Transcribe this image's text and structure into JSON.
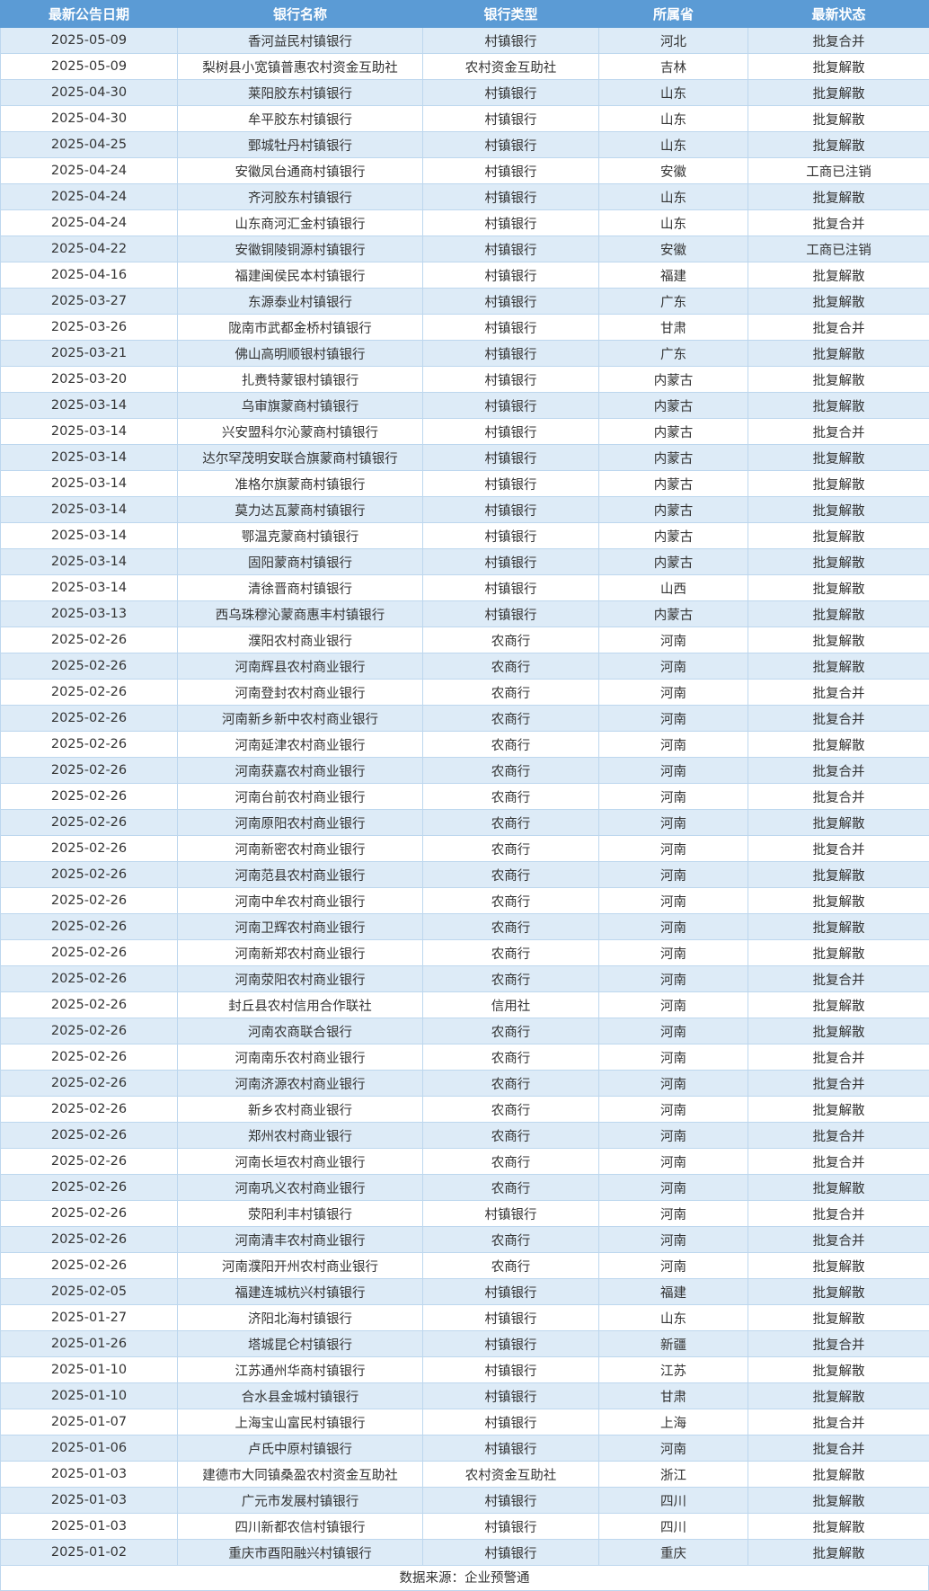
{
  "table": {
    "headers": [
      "最新公告日期",
      "银行名称",
      "银行类型",
      "所属省",
      "最新状态"
    ],
    "rows": [
      [
        "2025-05-09",
        "香河益民村镇银行",
        "村镇银行",
        "河北",
        "批复合并"
      ],
      [
        "2025-05-09",
        "梨树县小宽镇普惠农村资金互助社",
        "农村资金互助社",
        "吉林",
        "批复解散"
      ],
      [
        "2025-04-30",
        "莱阳胶东村镇银行",
        "村镇银行",
        "山东",
        "批复解散"
      ],
      [
        "2025-04-30",
        "牟平胶东村镇银行",
        "村镇银行",
        "山东",
        "批复解散"
      ],
      [
        "2025-04-25",
        "鄄城牡丹村镇银行",
        "村镇银行",
        "山东",
        "批复解散"
      ],
      [
        "2025-04-24",
        "安徽凤台通商村镇银行",
        "村镇银行",
        "安徽",
        "工商已注销"
      ],
      [
        "2025-04-24",
        "齐河胶东村镇银行",
        "村镇银行",
        "山东",
        "批复解散"
      ],
      [
        "2025-04-24",
        "山东商河汇金村镇银行",
        "村镇银行",
        "山东",
        "批复合并"
      ],
      [
        "2025-04-22",
        "安徽铜陵铜源村镇银行",
        "村镇银行",
        "安徽",
        "工商已注销"
      ],
      [
        "2025-04-16",
        "福建闽侯民本村镇银行",
        "村镇银行",
        "福建",
        "批复解散"
      ],
      [
        "2025-03-27",
        "东源泰业村镇银行",
        "村镇银行",
        "广东",
        "批复解散"
      ],
      [
        "2025-03-26",
        "陇南市武都金桥村镇银行",
        "村镇银行",
        "甘肃",
        "批复合并"
      ],
      [
        "2025-03-21",
        "佛山高明顺银村镇银行",
        "村镇银行",
        "广东",
        "批复解散"
      ],
      [
        "2025-03-20",
        "扎赉特蒙银村镇银行",
        "村镇银行",
        "内蒙古",
        "批复解散"
      ],
      [
        "2025-03-14",
        "乌审旗蒙商村镇银行",
        "村镇银行",
        "内蒙古",
        "批复解散"
      ],
      [
        "2025-03-14",
        "兴安盟科尔沁蒙商村镇银行",
        "村镇银行",
        "内蒙古",
        "批复合并"
      ],
      [
        "2025-03-14",
        "达尔罕茂明安联合旗蒙商村镇银行",
        "村镇银行",
        "内蒙古",
        "批复解散"
      ],
      [
        "2025-03-14",
        "准格尔旗蒙商村镇银行",
        "村镇银行",
        "内蒙古",
        "批复解散"
      ],
      [
        "2025-03-14",
        "莫力达瓦蒙商村镇银行",
        "村镇银行",
        "内蒙古",
        "批复解散"
      ],
      [
        "2025-03-14",
        "鄂温克蒙商村镇银行",
        "村镇银行",
        "内蒙古",
        "批复解散"
      ],
      [
        "2025-03-14",
        "固阳蒙商村镇银行",
        "村镇银行",
        "内蒙古",
        "批复解散"
      ],
      [
        "2025-03-14",
        "清徐晋商村镇银行",
        "村镇银行",
        "山西",
        "批复解散"
      ],
      [
        "2025-03-13",
        "西乌珠穆沁蒙商惠丰村镇银行",
        "村镇银行",
        "内蒙古",
        "批复解散"
      ],
      [
        "2025-02-26",
        "濮阳农村商业银行",
        "农商行",
        "河南",
        "批复解散"
      ],
      [
        "2025-02-26",
        "河南辉县农村商业银行",
        "农商行",
        "河南",
        "批复解散"
      ],
      [
        "2025-02-26",
        "河南登封农村商业银行",
        "农商行",
        "河南",
        "批复合并"
      ],
      [
        "2025-02-26",
        "河南新乡新中农村商业银行",
        "农商行",
        "河南",
        "批复合并"
      ],
      [
        "2025-02-26",
        "河南延津农村商业银行",
        "农商行",
        "河南",
        "批复解散"
      ],
      [
        "2025-02-26",
        "河南获嘉农村商业银行",
        "农商行",
        "河南",
        "批复合并"
      ],
      [
        "2025-02-26",
        "河南台前农村商业银行",
        "农商行",
        "河南",
        "批复合并"
      ],
      [
        "2025-02-26",
        "河南原阳农村商业银行",
        "农商行",
        "河南",
        "批复解散"
      ],
      [
        "2025-02-26",
        "河南新密农村商业银行",
        "农商行",
        "河南",
        "批复合并"
      ],
      [
        "2025-02-26",
        "河南范县农村商业银行",
        "农商行",
        "河南",
        "批复解散"
      ],
      [
        "2025-02-26",
        "河南中牟农村商业银行",
        "农商行",
        "河南",
        "批复解散"
      ],
      [
        "2025-02-26",
        "河南卫辉农村商业银行",
        "农商行",
        "河南",
        "批复解散"
      ],
      [
        "2025-02-26",
        "河南新郑农村商业银行",
        "农商行",
        "河南",
        "批复解散"
      ],
      [
        "2025-02-26",
        "河南荥阳农村商业银行",
        "农商行",
        "河南",
        "批复合并"
      ],
      [
        "2025-02-26",
        "封丘县农村信用合作联社",
        "信用社",
        "河南",
        "批复解散"
      ],
      [
        "2025-02-26",
        "河南农商联合银行",
        "农商行",
        "河南",
        "批复解散"
      ],
      [
        "2025-02-26",
        "河南南乐农村商业银行",
        "农商行",
        "河南",
        "批复合并"
      ],
      [
        "2025-02-26",
        "河南济源农村商业银行",
        "农商行",
        "河南",
        "批复合并"
      ],
      [
        "2025-02-26",
        "新乡农村商业银行",
        "农商行",
        "河南",
        "批复解散"
      ],
      [
        "2025-02-26",
        "郑州农村商业银行",
        "农商行",
        "河南",
        "批复合并"
      ],
      [
        "2025-02-26",
        "河南长垣农村商业银行",
        "农商行",
        "河南",
        "批复合并"
      ],
      [
        "2025-02-26",
        "河南巩义农村商业银行",
        "农商行",
        "河南",
        "批复解散"
      ],
      [
        "2025-02-26",
        "荥阳利丰村镇银行",
        "村镇银行",
        "河南",
        "批复合并"
      ],
      [
        "2025-02-26",
        "河南清丰农村商业银行",
        "农商行",
        "河南",
        "批复合并"
      ],
      [
        "2025-02-26",
        "河南濮阳开州农村商业银行",
        "农商行",
        "河南",
        "批复解散"
      ],
      [
        "2025-02-05",
        "福建连城杭兴村镇银行",
        "村镇银行",
        "福建",
        "批复解散"
      ],
      [
        "2025-01-27",
        "济阳北海村镇银行",
        "村镇银行",
        "山东",
        "批复解散"
      ],
      [
        "2025-01-26",
        "塔城昆仑村镇银行",
        "村镇银行",
        "新疆",
        "批复合并"
      ],
      [
        "2025-01-10",
        "江苏通州华商村镇银行",
        "村镇银行",
        "江苏",
        "批复解散"
      ],
      [
        "2025-01-10",
        "合水县金城村镇银行",
        "村镇银行",
        "甘肃",
        "批复解散"
      ],
      [
        "2025-01-07",
        "上海宝山富民村镇银行",
        "村镇银行",
        "上海",
        "批复合并"
      ],
      [
        "2025-01-06",
        "卢氏中原村镇银行",
        "村镇银行",
        "河南",
        "批复合并"
      ],
      [
        "2025-01-03",
        "建德市大同镇桑盈农村资金互助社",
        "农村资金互助社",
        "浙江",
        "批复解散"
      ],
      [
        "2025-01-03",
        "广元市发展村镇银行",
        "村镇银行",
        "四川",
        "批复解散"
      ],
      [
        "2025-01-03",
        "四川新都农信村镇银行",
        "村镇银行",
        "四川",
        "批复解散"
      ],
      [
        "2025-01-02",
        "重庆市酉阳融兴村镇银行",
        "村镇银行",
        "重庆",
        "批复解散"
      ]
    ]
  },
  "footer": {
    "source": "数据来源：企业预警通"
  },
  "colors": {
    "header_bg": "#5b9bd5",
    "header_text": "#ffffff",
    "row_stripe": "#ddebf7",
    "grid_line": "#bdd7ee"
  }
}
